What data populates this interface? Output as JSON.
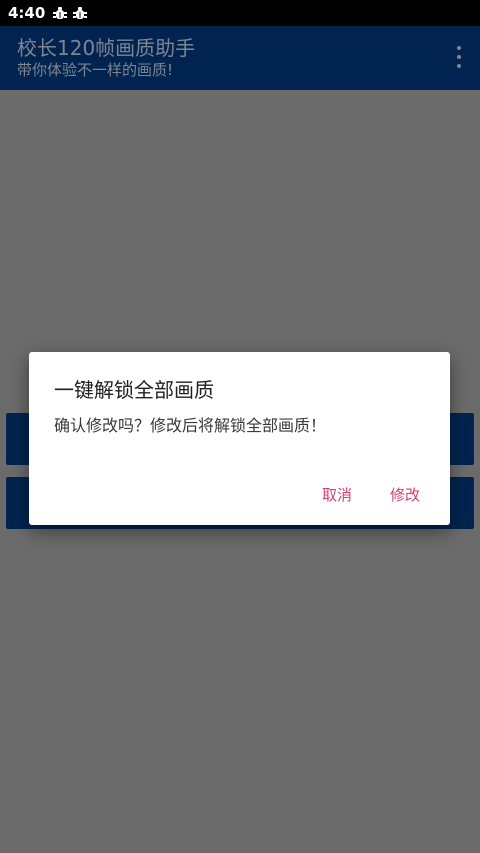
{
  "status_bar": {
    "time": "4:40",
    "icons": [
      "bug-icon",
      "bug-icon"
    ]
  },
  "app_bar": {
    "title": "校长120帧画质助手",
    "subtitle": "带你体验不一样的画质!",
    "menu_icon": "more-vertical-icon"
  },
  "dialog": {
    "title": "一键解锁全部画质",
    "message": "确认修改吗？修改后将解锁全部画质！",
    "cancel_label": "取消",
    "confirm_label": "修改",
    "accent_color": "#d2416f"
  },
  "colors": {
    "app_bar": "#00244f",
    "scrim": "#6b6b6b",
    "status_bar": "#000000"
  }
}
